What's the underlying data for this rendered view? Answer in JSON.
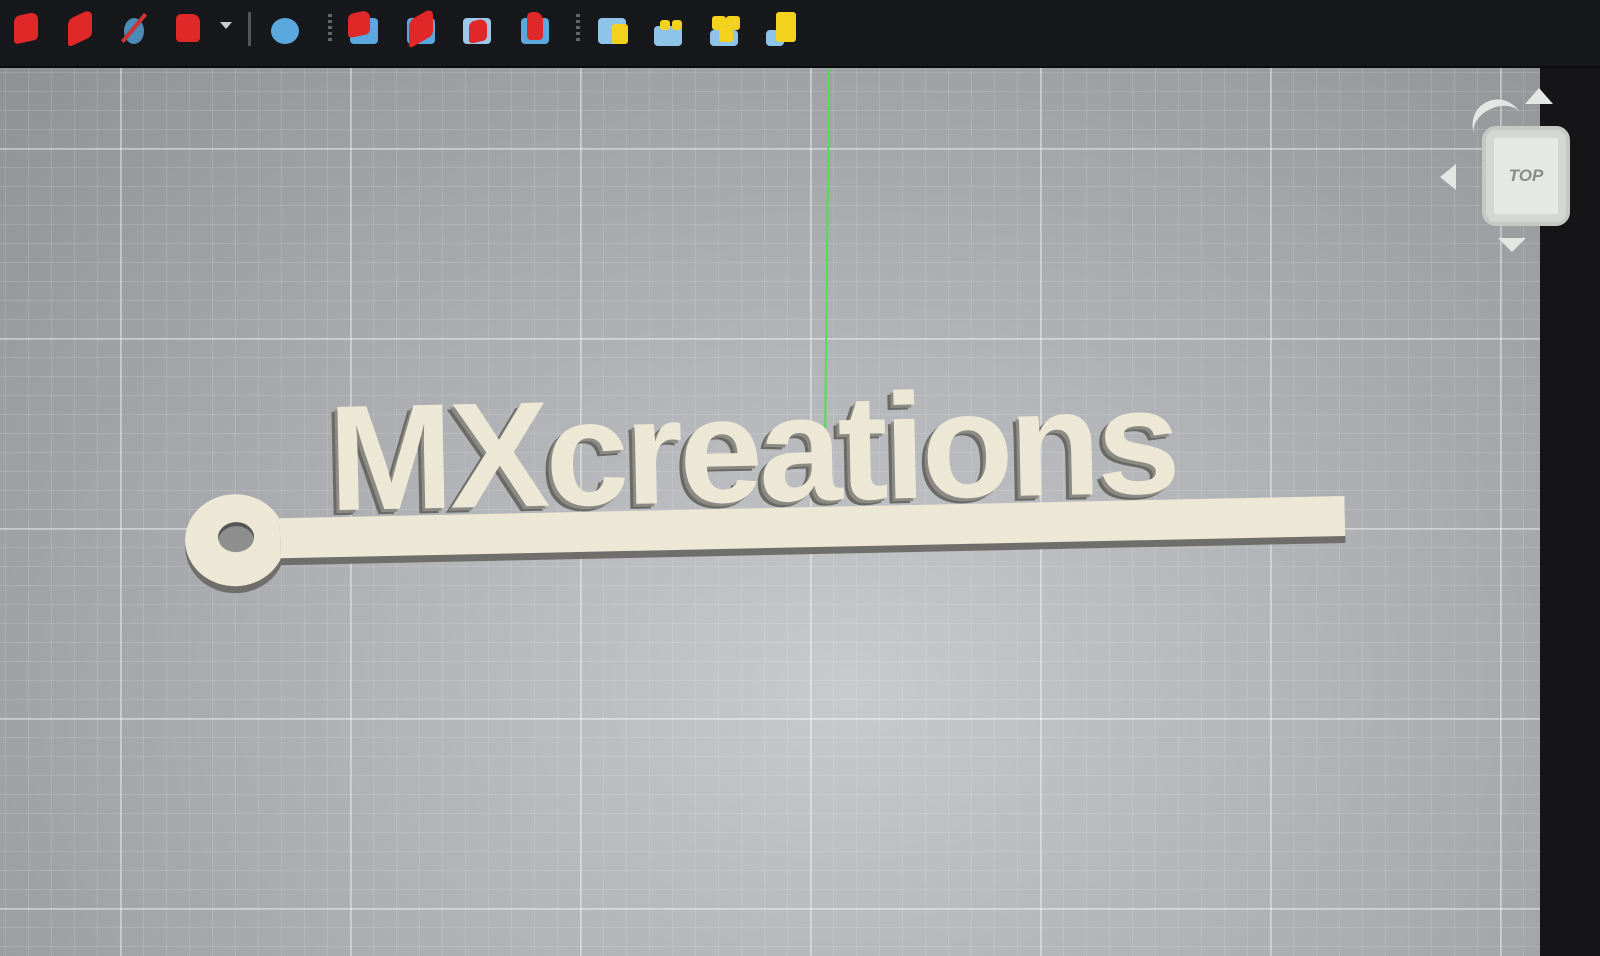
{
  "toolbar": {
    "icons": [
      "part-box-red-icon",
      "part-chamfer-icon",
      "part-section-icon",
      "part-extrude-icon",
      "dropdown-icon",
      "sphere-icon",
      "view-axonometric-icon",
      "view-front-icon",
      "view-top-icon",
      "view-right-icon",
      "assembly-icon",
      "assembly-constraints-icon",
      "assembly-parts-icon",
      "assembly-explode-icon"
    ]
  },
  "model": {
    "text": "MXcreations"
  },
  "navcube": {
    "face_label": "TOP"
  },
  "colors": {
    "axis_y": "#4fe04f",
    "model": "#ede8d6",
    "toolbar": "#17181b",
    "part_red": "#e02828",
    "part_blue": "#5aa8de",
    "part_yellow": "#f3d21e"
  }
}
